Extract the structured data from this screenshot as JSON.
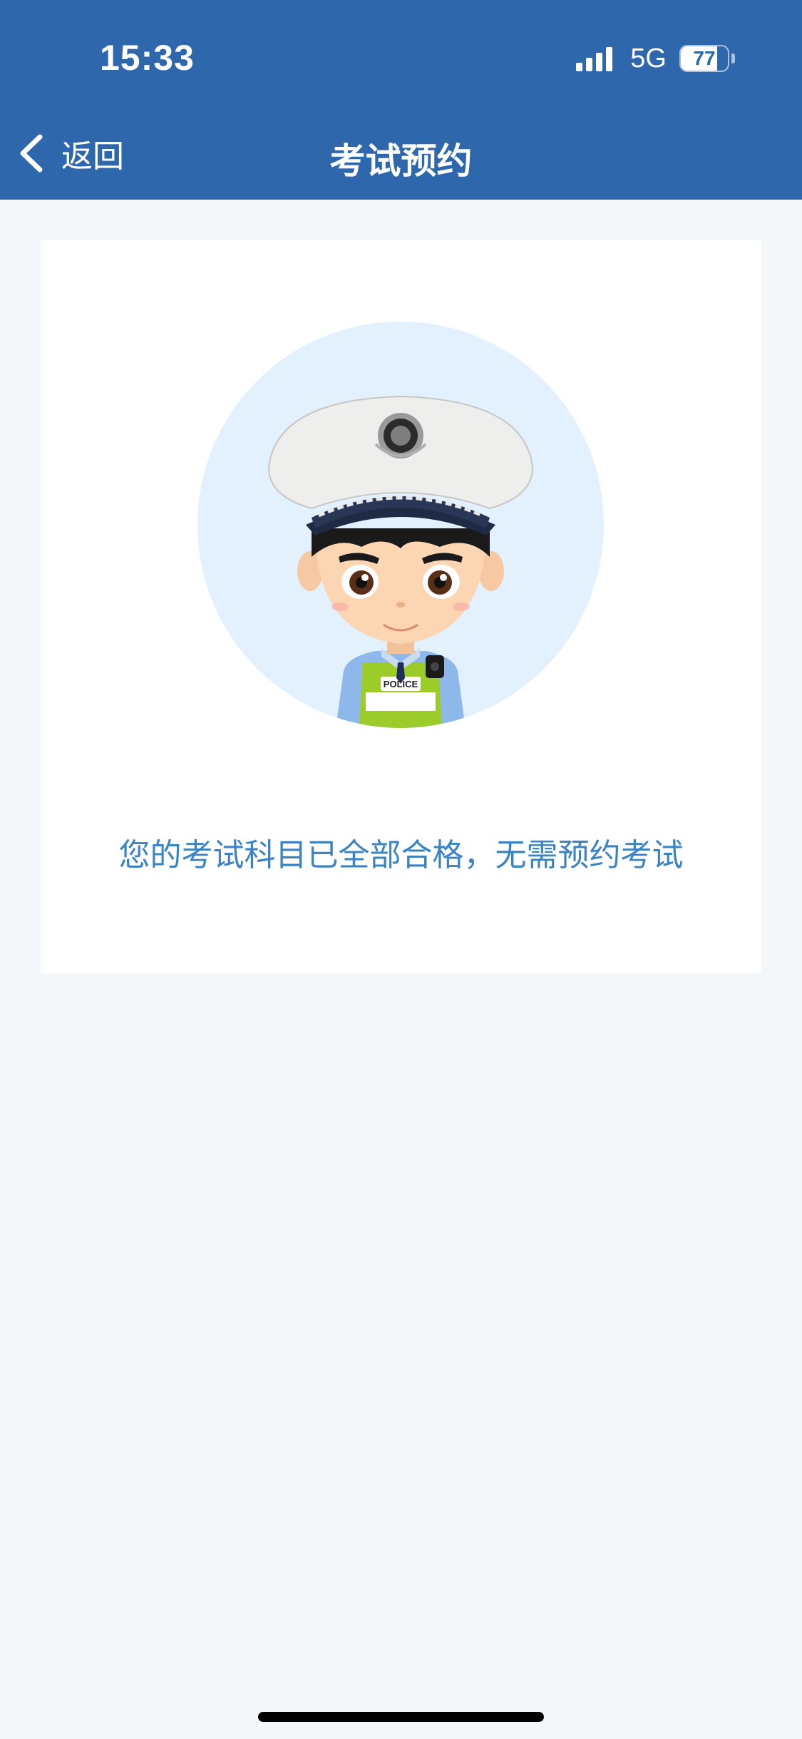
{
  "status_bar": {
    "time": "15:33",
    "network": "5G",
    "battery": "77",
    "battery_level": 0.77,
    "signal_bars": 4
  },
  "nav": {
    "back_label": "返回",
    "title": "考试预约"
  },
  "avatar": {
    "badge_text": "POLICE",
    "icon": "police-officer-icon"
  },
  "message": "您的考试科目已全部合格，无需预约考试",
  "colors": {
    "header": "#2e67ac",
    "background": "#f3f7f9",
    "message": "#3a83c5",
    "avatar_circle": "#e3f0fd"
  }
}
